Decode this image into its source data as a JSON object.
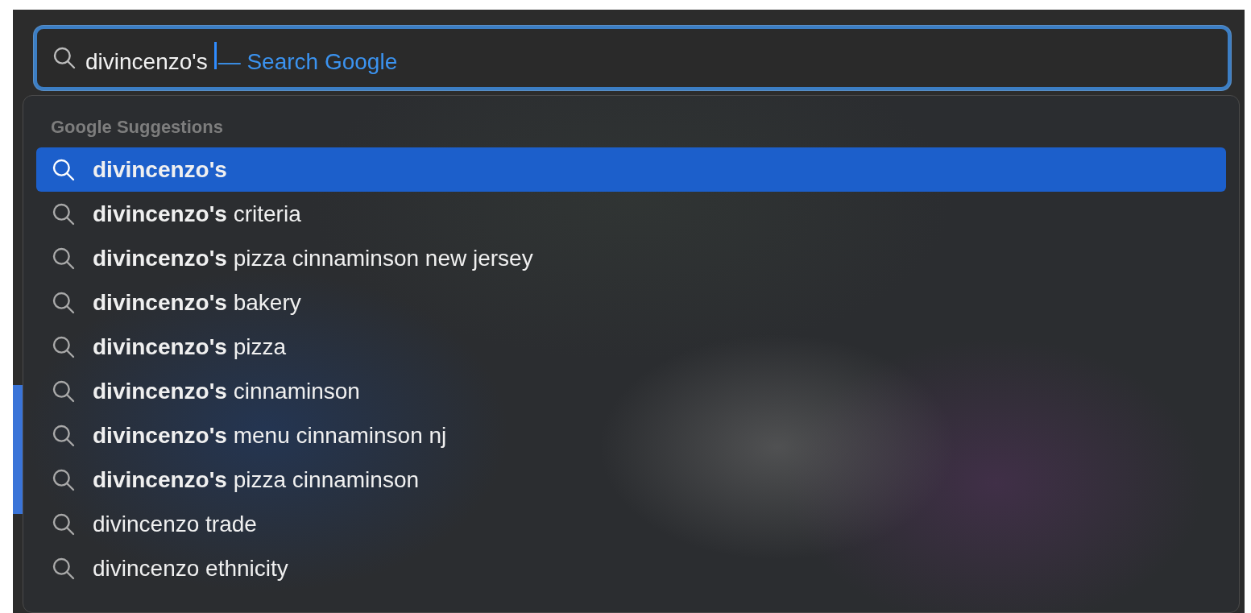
{
  "search_field": {
    "value": "divincenzo's",
    "hint": "— Search Google"
  },
  "suggestions": {
    "heading": "Google Suggestions",
    "items": [
      {
        "text": "**divincenzo's**",
        "selected": true
      },
      {
        "text": "**divincenzo's** criteria",
        "selected": false
      },
      {
        "text": "**divincenzo's** pizza cinnaminson new jersey",
        "selected": false
      },
      {
        "text": "**divincenzo's** bakery",
        "selected": false
      },
      {
        "text": "**divincenzo's** pizza",
        "selected": false
      },
      {
        "text": "**divincenzo's** cinnaminson",
        "selected": false
      },
      {
        "text": "**divincenzo's** menu cinnaminson nj",
        "selected": false
      },
      {
        "text": "**divincenzo's** pizza cinnaminson",
        "selected": false
      },
      {
        "text": "divincenzo trade",
        "selected": false
      },
      {
        "text": "divincenzo ethnicity",
        "selected": false
      }
    ]
  }
}
